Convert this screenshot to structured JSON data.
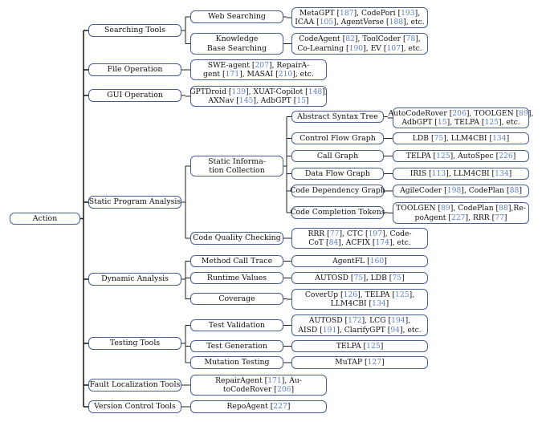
{
  "accent_color": "#4a5f8f",
  "ref_color": "#5b7fc4",
  "root": "Action",
  "categories": [
    {
      "label": "Searching Tools",
      "children": [
        {
          "label": "Web Searching",
          "works": [
            [
              "MetaGPT ",
              "187",
              ", CodePori ",
              "193",
              ","
            ],
            [
              "ICAA ",
              "105",
              ", AgentVerse ",
              "188",
              ", etc."
            ]
          ]
        },
        {
          "label": "Knowledge Base Searching",
          "lines": [
            "Knowledge",
            "Base Searching"
          ],
          "works": [
            [
              "CodeAgent ",
              "82",
              ", ToolCoder ",
              "78",
              ","
            ],
            [
              "Co-Learning ",
              "190",
              ", EV ",
              "107",
              ", etc."
            ]
          ]
        }
      ]
    },
    {
      "label": "File Operation",
      "works": [
        [
          "SWE-agent ",
          "207",
          ", RepairA-"
        ],
        [
          "gent ",
          "171",
          ", MASAI ",
          "210",
          ", etc."
        ]
      ]
    },
    {
      "label": "GUI Operation",
      "works": [
        [
          "GPTDroid ",
          "139",
          ", XUAT-Copilot ",
          "148",
          ","
        ],
        [
          "AXNav ",
          "145",
          ", AdbGPT ",
          "15",
          ""
        ]
      ]
    },
    {
      "label": "Static Program Analysis",
      "children": [
        {
          "label": "Static Information Collection",
          "lines": [
            "Static Informa-",
            "tion Collection"
          ],
          "children": [
            {
              "label": "Abstract Syntax Tree",
              "works": [
                [
                  "AutoCodeRover ",
                  "206",
                  ", TOOLGEN ",
                  "89",
                  ","
                ],
                [
                  "AdbGPT ",
                  "15",
                  ", TELPA ",
                  "125",
                  ", etc."
                ]
              ]
            },
            {
              "label": "Control Flow Graph",
              "works": [
                [
                  "LDB ",
                  "75",
                  ", LLM4CBI ",
                  "134",
                  ""
                ]
              ]
            },
            {
              "label": "Call Graph",
              "works": [
                [
                  "TELPA ",
                  "125",
                  ", AutoSpec ",
                  "226",
                  ""
                ]
              ]
            },
            {
              "label": "Data Flow Graph",
              "works": [
                [
                  "IRIS ",
                  "113",
                  ", LLM4CBI ",
                  "134",
                  ""
                ]
              ]
            },
            {
              "label": "Code Dependency Graph",
              "works": [
                [
                  "AgileCoder ",
                  "198",
                  ", CodePlan ",
                  "88",
                  ""
                ]
              ]
            },
            {
              "label": "Code Completion Tokens",
              "works": [
                [
                  "TOOLGEN ",
                  "89",
                  ", CodePlan ",
                  "88",
                  ",Re-"
                ],
                [
                  "poAgent ",
                  "227",
                  ", RRR ",
                  "77",
                  ""
                ]
              ]
            }
          ]
        },
        {
          "label": "Code Quality Checking",
          "works": [
            [
              "RRR ",
              "77",
              ", CTC ",
              "197",
              ", Code-"
            ],
            [
              "CoT ",
              "84",
              ", ACFIX ",
              "174",
              ", etc."
            ]
          ]
        }
      ]
    },
    {
      "label": "Dynamic Analysis",
      "children": [
        {
          "label": "Method Call Trace",
          "works": [
            [
              "AgentFL ",
              "160",
              ""
            ]
          ]
        },
        {
          "label": "Runtime Values",
          "works": [
            [
              "AUTOSD ",
              "75",
              ", LDB ",
              "75",
              ""
            ]
          ]
        },
        {
          "label": "Coverage",
          "works": [
            [
              "CoverUp ",
              "126",
              ", TELPA ",
              "125",
              ","
            ],
            [
              "LLM4CBI ",
              "134",
              ""
            ]
          ]
        }
      ]
    },
    {
      "label": "Testing Tools",
      "children": [
        {
          "label": "Test Validation",
          "works": [
            [
              "AUTOSD ",
              "172",
              ", LCG ",
              "194",
              ","
            ],
            [
              "AISD ",
              "191",
              ", ClarifyGPT ",
              "94",
              ", etc."
            ]
          ]
        },
        {
          "label": "Test Generation",
          "works": [
            [
              "TELPA ",
              "125",
              ""
            ]
          ]
        },
        {
          "label": "Mutation Testing",
          "works": [
            [
              "MuTAP ",
              "127",
              ""
            ]
          ]
        }
      ]
    },
    {
      "label": "Fault Localization Tools",
      "works": [
        [
          "RepairAgent ",
          "171",
          ", Au-"
        ],
        [
          "toCodeRover ",
          "206",
          ""
        ]
      ]
    },
    {
      "label": "Version Control Tools",
      "works": [
        [
          "RepoAgent ",
          "227",
          ""
        ]
      ]
    }
  ]
}
